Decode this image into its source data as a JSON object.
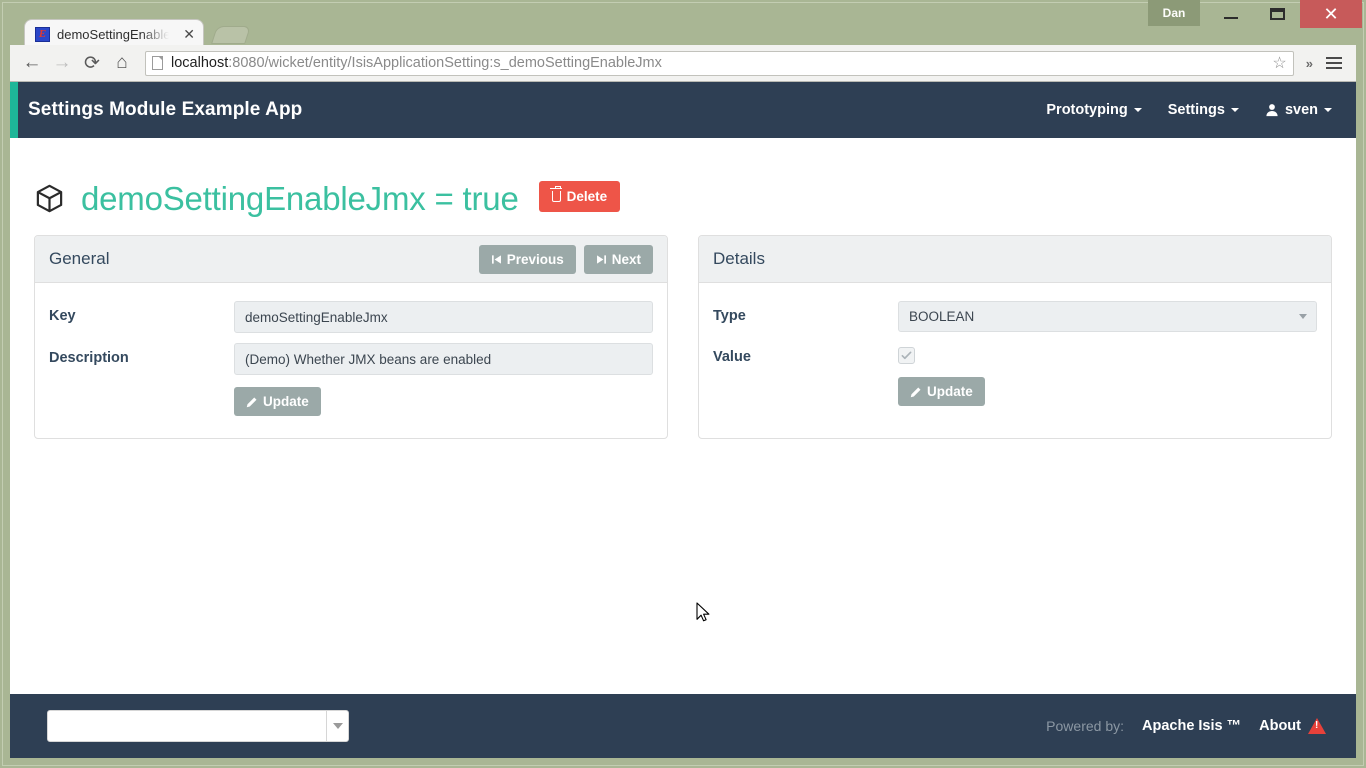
{
  "window": {
    "user_badge": "Dan",
    "minimize_label": "Minimize",
    "maximize_label": "Maximize",
    "close_label": "✕"
  },
  "browser": {
    "tab": {
      "title": "demoSettingEnableJ",
      "favicon_letter": "E",
      "close_label": "✕"
    },
    "new_tab_label": "",
    "toolbar": {
      "back": "←",
      "forward": "→",
      "reload": "⟳",
      "home": "⌂",
      "overflow": "»"
    },
    "url": {
      "host": "localhost",
      "rest": ":8080/wicket/entity/IsisApplicationSetting:s_demoSettingEnableJmx",
      "full": "localhost:8080/wicket/entity/IsisApplicationSetting:s_demoSettingEnableJmx",
      "bookmark_star": "☆"
    }
  },
  "header": {
    "brand": "Settings Module Example App",
    "nav": [
      {
        "label": "Prototyping",
        "has_caret": true
      },
      {
        "label": "Settings",
        "has_caret": true
      },
      {
        "label": "sven",
        "has_caret": true,
        "icon": "user-icon"
      }
    ]
  },
  "page": {
    "title": "demoSettingEnableJmx = true",
    "icon": "cube-icon",
    "delete_button": "Delete"
  },
  "general_panel": {
    "title": "General",
    "previous_button": "Previous",
    "next_button": "Next",
    "fields": [
      {
        "label": "Key",
        "value": "demoSettingEnableJmx"
      },
      {
        "label": "Description",
        "value": "(Demo) Whether JMX beans are enabled"
      }
    ],
    "update_button": "Update"
  },
  "details_panel": {
    "title": "Details",
    "type_label": "Type",
    "type_value": "BOOLEAN",
    "value_label": "Value",
    "value_checked": true,
    "update_button": "Update"
  },
  "footer": {
    "select_value": "",
    "powered_by": "Powered by:",
    "product": "Apache Isis ™",
    "about": "About"
  },
  "colors": {
    "header_bg": "#2e3f54",
    "accent_teal": "#1eb698",
    "title_green": "#3bc0a0",
    "delete_red": "#ee5548",
    "button_gray": "#9ba9a8",
    "frame_green": "#a9b694"
  }
}
